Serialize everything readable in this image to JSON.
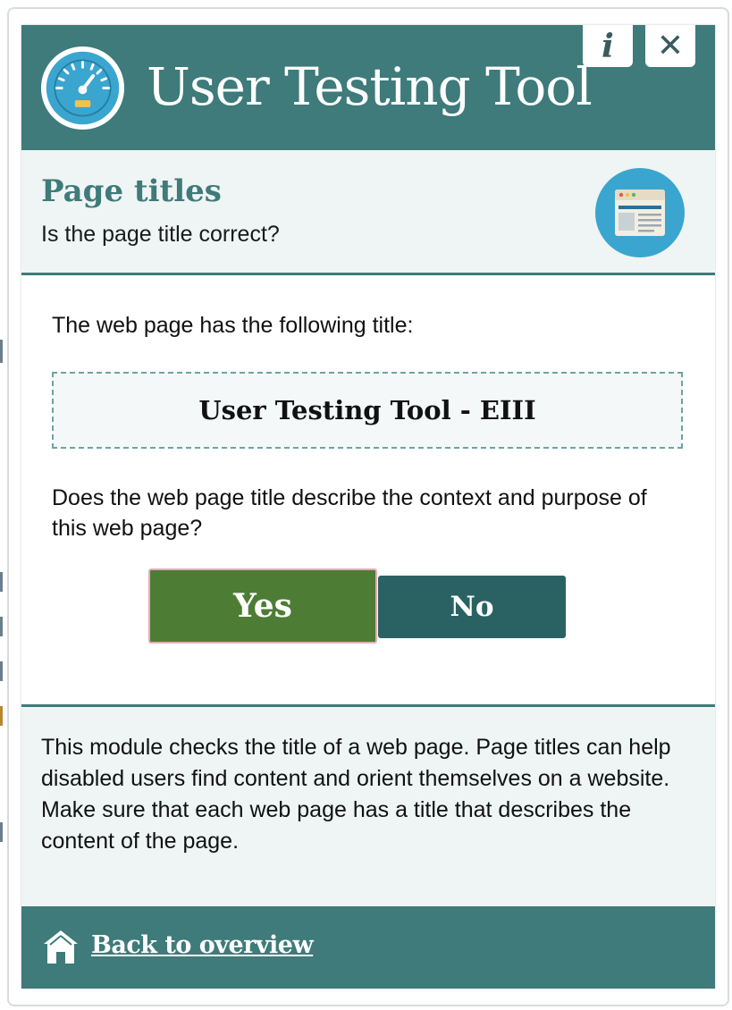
{
  "header": {
    "title": "User Testing Tool",
    "info_label": "i",
    "close_label": "✕",
    "logo_icon": "speedometer-icon"
  },
  "section": {
    "title": "Page titles",
    "subtitle": "Is the page title correct?",
    "icon": "webpage-icon"
  },
  "main": {
    "intro": "The web page has the following title:",
    "page_title_value": "User Testing Tool - EIII",
    "question": "Does the web page title describe the context and purpose of this web page?",
    "yes_label": "Yes",
    "no_label": "No"
  },
  "description": {
    "text": "This module checks the title of a web page. Page titles can help disabled users find content and orient themselves on a website. Make sure that each web page has a title that describes the content of the page."
  },
  "footer": {
    "back_label": "Back to overview",
    "home_icon": "home-icon"
  },
  "colors": {
    "teal": "#3e7b7a",
    "dark_teal": "#2a6264",
    "green": "#4d7d34",
    "light_bg": "#eff4f4",
    "icon_blue": "#3aa6d0"
  }
}
